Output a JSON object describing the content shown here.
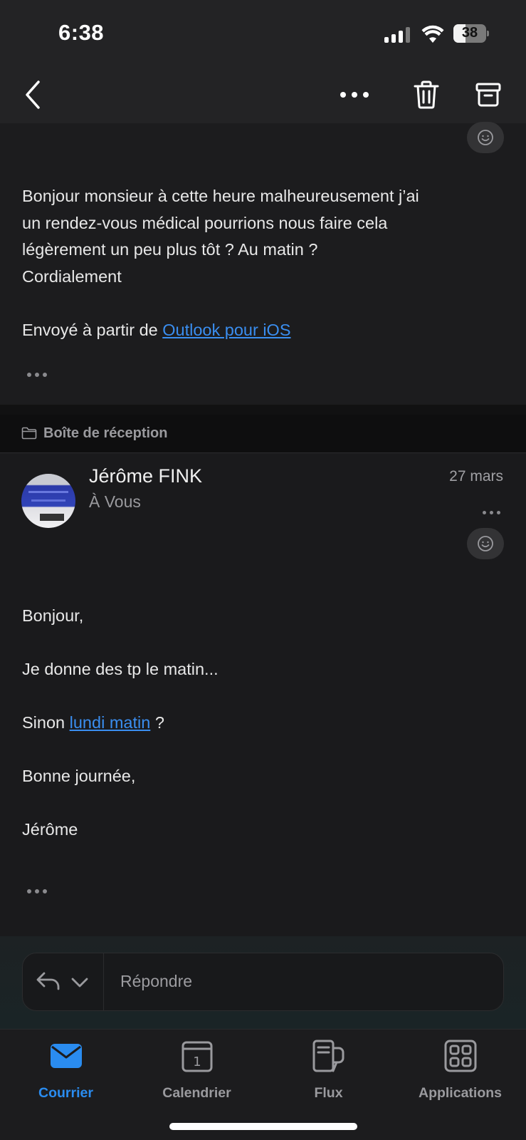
{
  "status_bar": {
    "time": "6:38",
    "battery_level": "38",
    "battery_fraction": 0.38,
    "icons": [
      "signal-icon",
      "wifi-icon",
      "battery-icon"
    ]
  },
  "nav_bar": {
    "icons": [
      "back-chevron-icon",
      "more-horizontal-icon",
      "trash-icon",
      "archive-icon"
    ]
  },
  "message_1": {
    "body_lines": [
      "Bonjour monsieur à cette heure malheureusement j’ai",
      "un rendez-vous médical pourrions nous faire cela",
      "légèrement un peu plus tôt ? Au matin ?",
      "Cordialement"
    ],
    "signature_prefix": "Envoyé à partir de ",
    "signature_link": "Outlook pour iOS"
  },
  "folder": {
    "label": "Boîte de réception",
    "icon": "folder-icon"
  },
  "message_2": {
    "sender": "Jérôme FINK",
    "recipient": "À Vous",
    "date": "27 mars",
    "greeting": "Bonjour,",
    "line1": "Je donne des tp le matin...",
    "line2_prefix": "Sinon ",
    "line2_link": "lundi matin",
    "line2_suffix": " ?",
    "closing": "Bonne journée,",
    "signature": "Jérôme"
  },
  "reply_bar": {
    "placeholder": "Répondre",
    "icons": [
      "reply-icon",
      "chevron-down-icon"
    ]
  },
  "tab_bar": {
    "tabs": [
      {
        "label": "Courrier",
        "icon": "mail-icon",
        "active": true
      },
      {
        "label": "Calendrier",
        "icon": "calendar-icon",
        "active": false
      },
      {
        "label": "Flux",
        "icon": "feed-icon",
        "active": false
      },
      {
        "label": "Applications",
        "icon": "apps-grid-icon",
        "active": false
      }
    ]
  },
  "colors": {
    "accent": "#2a8cf0",
    "link": "#3a8ef0",
    "background": "#1c1c1e"
  }
}
